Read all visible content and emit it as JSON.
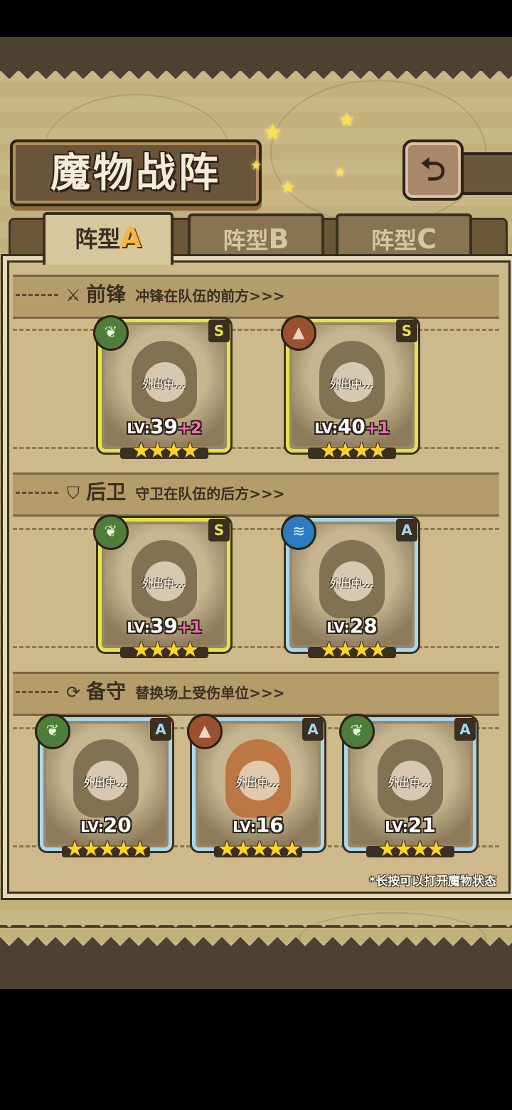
{
  "title": "魔物战阵",
  "back_icon": "return-arrow-icon",
  "tabs": [
    {
      "prefix": "阵型",
      "letter": "A",
      "active": true
    },
    {
      "prefix": "阵型",
      "letter": "B",
      "active": false
    },
    {
      "prefix": "阵型",
      "letter": "C",
      "active": false
    }
  ],
  "sections": {
    "front": {
      "icon": "sword-icon",
      "name": "前锋",
      "desc": "冲锋在队伍的前方>>>"
    },
    "back": {
      "icon": "shield-icon",
      "name": "后卫",
      "desc": "守卫在队伍的后方>>>"
    },
    "reserve": {
      "icon": "swap-icon",
      "name": "备守",
      "desc": "替换场上受伤单位>>>"
    }
  },
  "units": [
    {
      "element": "leaf",
      "grade": "S",
      "status": "外出中...",
      "lv_label": "LV:",
      "level": "39",
      "bonus": "+2",
      "stars": 4
    },
    {
      "element": "earth",
      "grade": "S",
      "status": "外出中...",
      "lv_label": "LV:",
      "level": "40",
      "bonus": "+1",
      "stars": 4
    },
    {
      "element": "leaf",
      "grade": "S",
      "status": "外出中...",
      "lv_label": "LV:",
      "level": "39",
      "bonus": "+1",
      "stars": 4
    },
    {
      "element": "water",
      "grade": "A",
      "status": "外出中...",
      "lv_label": "LV:",
      "level": "28",
      "bonus": "",
      "stars": 4
    },
    {
      "element": "leaf",
      "grade": "A",
      "status": "外出中...",
      "lv_label": "LV:",
      "level": "20",
      "bonus": "",
      "stars": 5
    },
    {
      "element": "earth",
      "grade": "A",
      "status": "外出中...",
      "lv_label": "LV:",
      "level": "16",
      "bonus": "",
      "stars": 5
    },
    {
      "element": "leaf",
      "grade": "A",
      "status": "外出中...",
      "lv_label": "LV:",
      "level": "21",
      "bonus": "",
      "stars": 4
    }
  ],
  "hint": "*长按可以打开魔物状态",
  "colors": {
    "s_border": "#e8e24a",
    "a_border": "#a8d8ee",
    "tab_accent": "#f6b73a",
    "bonus": "#ff6bb0"
  }
}
